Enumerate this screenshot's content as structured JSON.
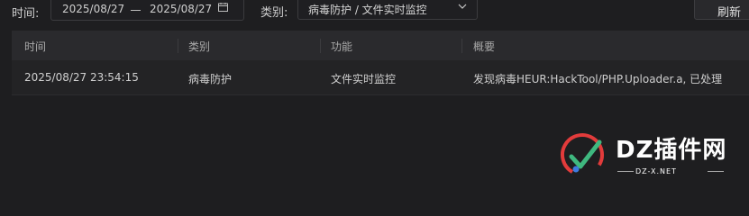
{
  "toolbar": {
    "time_label": "时间:",
    "date_start": "2025/08/27",
    "date_end": "2025/08/27",
    "category_label": "类别:",
    "category_value": "病毒防护 / 文件实时监控",
    "refresh_label": "刷新"
  },
  "table": {
    "columns": [
      "时间",
      "类别",
      "功能",
      "概要"
    ],
    "rows": [
      {
        "time": "2025/08/27 23:54:15",
        "category": "病毒防护",
        "function": "文件实时监控",
        "summary": "发现病毒HEUR:HackTool/PHP.Uploader.a, 已处理"
      }
    ]
  },
  "watermark": {
    "title": "DZ插件网",
    "subtitle": "DZ-X.NET"
  },
  "colors": {
    "background": "#1e1e20",
    "header_bg": "#2a2a2d",
    "row_bg": "#232325",
    "watermark_red": "#e23b3b",
    "watermark_green": "#3fb87f",
    "watermark_blue": "#3d7be0"
  }
}
